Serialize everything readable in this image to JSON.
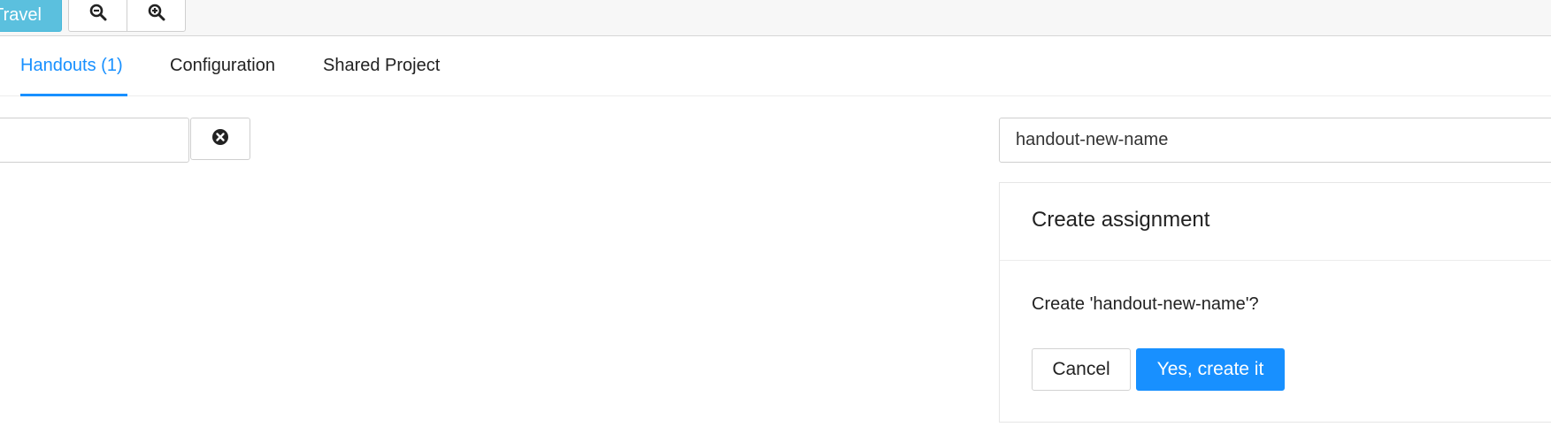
{
  "toolbar": {
    "travel_label": "Travel",
    "zoom_out_icon": "zoom-out-icon",
    "zoom_in_icon": "zoom-in-icon",
    "accent_color": "#5bc0de"
  },
  "tabs": [
    {
      "label": "Handouts (1)",
      "active": true
    },
    {
      "label": "Configuration",
      "active": false
    },
    {
      "label": "Shared Project",
      "active": false
    }
  ],
  "filter": {
    "value": "",
    "clear_icon": "clear-circle-icon"
  },
  "name_input": {
    "value": "handout-new-name"
  },
  "dialog": {
    "title": "Create assignment",
    "message": "Create 'handout-new-name'?",
    "cancel_label": "Cancel",
    "confirm_label": "Yes, create it",
    "primary_color": "#1890ff"
  }
}
